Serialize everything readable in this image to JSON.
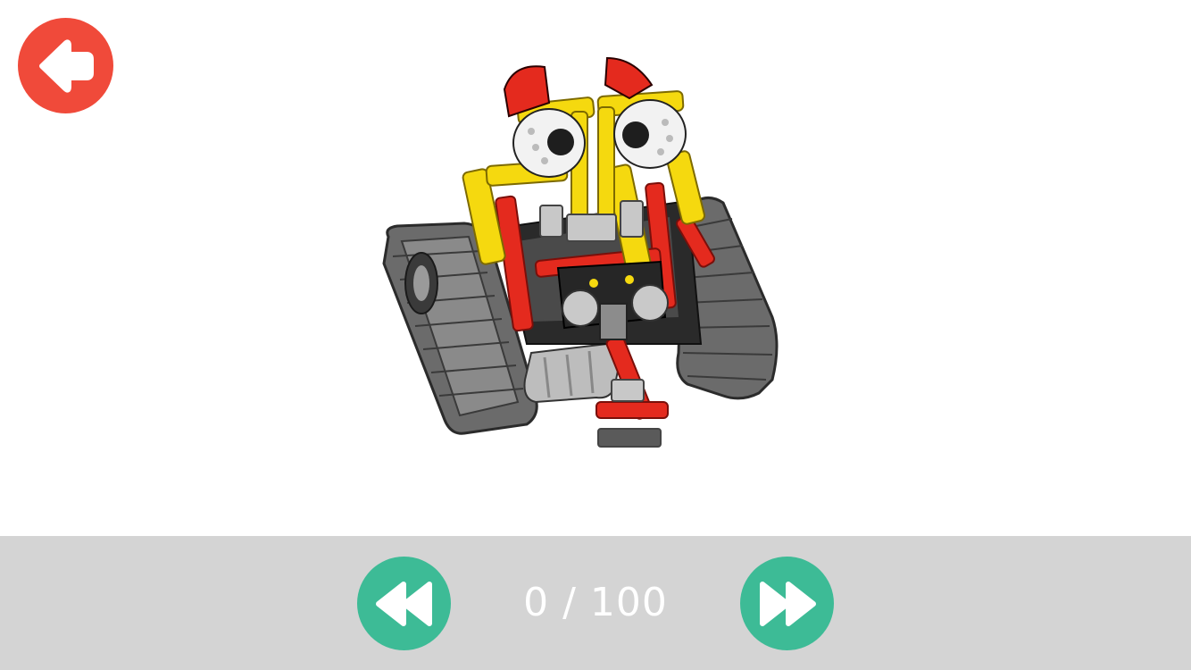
{
  "header": {
    "back_icon": "arrow-left-icon"
  },
  "viewer": {
    "model_icon": "robot-model-image"
  },
  "footer": {
    "step_current": "0",
    "step_separator": "/",
    "step_total": "100",
    "step_text": "0 / 100",
    "prev_icon": "rewind-icon",
    "next_icon": "fast-forward-icon"
  },
  "colors": {
    "back_button": "#f04a3a",
    "nav_button": "#3dbb96",
    "footer_bg": "#d4d4d4",
    "counter_text": "#ffffff"
  }
}
